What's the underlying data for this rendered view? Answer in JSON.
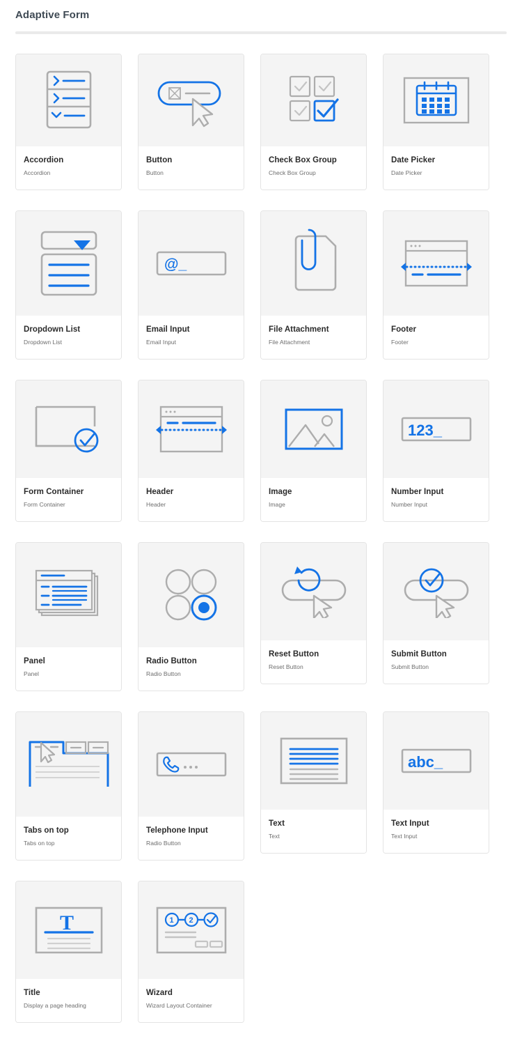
{
  "page": {
    "title": "Adaptive Form",
    "accent_color": "#1473e6",
    "icon_gray": "#adadad",
    "thumb_bg": "#f4f4f4",
    "card_border": "#e4e4e4",
    "title_color": "#2b2b2b",
    "subtitle_color": "#6d6d6d",
    "rule_color": "#eaeaea"
  },
  "components": [
    {
      "title": "Accordion",
      "subtitle": "Accordion",
      "icon": "accordion-icon"
    },
    {
      "title": "Button",
      "subtitle": "Button",
      "icon": "button-icon"
    },
    {
      "title": "Check Box Group",
      "subtitle": "Check Box Group",
      "icon": "checkbox-group-icon"
    },
    {
      "title": "Date Picker",
      "subtitle": "Date Picker",
      "icon": "calendar-icon"
    },
    {
      "title": "Dropdown List",
      "subtitle": "Dropdown List",
      "icon": "dropdown-list-icon"
    },
    {
      "title": "Email Input",
      "subtitle": "Email Input",
      "icon": "email-input-icon"
    },
    {
      "title": "File Attachment",
      "subtitle": "File Attachment",
      "icon": "paperclip-document-icon"
    },
    {
      "title": "Footer",
      "subtitle": "Footer",
      "icon": "footer-icon"
    },
    {
      "title": "Form Container",
      "subtitle": "Form Container",
      "icon": "form-container-icon"
    },
    {
      "title": "Header",
      "subtitle": "Header",
      "icon": "header-icon"
    },
    {
      "title": "Image",
      "subtitle": "Image",
      "icon": "image-icon"
    },
    {
      "title": "Number Input",
      "subtitle": "Number Input",
      "icon": "number-input-icon"
    },
    {
      "title": "Panel",
      "subtitle": "Panel",
      "icon": "panel-icon"
    },
    {
      "title": "Radio Button",
      "subtitle": "Radio Button",
      "icon": "radio-button-icon"
    },
    {
      "title": "Reset Button",
      "subtitle": "Reset Button",
      "icon": "reset-button-icon"
    },
    {
      "title": "Submit Button",
      "subtitle": "Submit Button",
      "icon": "submit-button-icon"
    },
    {
      "title": "Tabs on top",
      "subtitle": "Tabs on top",
      "icon": "tabs-on-top-icon"
    },
    {
      "title": "Telephone Input",
      "subtitle": "Radio Button",
      "icon": "telephone-input-icon"
    },
    {
      "title": "Text",
      "subtitle": "Text",
      "icon": "text-icon"
    },
    {
      "title": "Text Input",
      "subtitle": "Text Input",
      "icon": "text-input-icon"
    },
    {
      "title": "Title",
      "subtitle": "Display a page heading",
      "icon": "title-icon"
    },
    {
      "title": "Wizard",
      "subtitle": "Wizard Layout Container",
      "icon": "wizard-icon"
    }
  ],
  "icon_glyphs": {
    "number_input_text": "123_",
    "email_input_text": "@_",
    "text_input_text": "abc_",
    "title_letter": "T",
    "wizard_steps": [
      "1",
      "2"
    ]
  }
}
